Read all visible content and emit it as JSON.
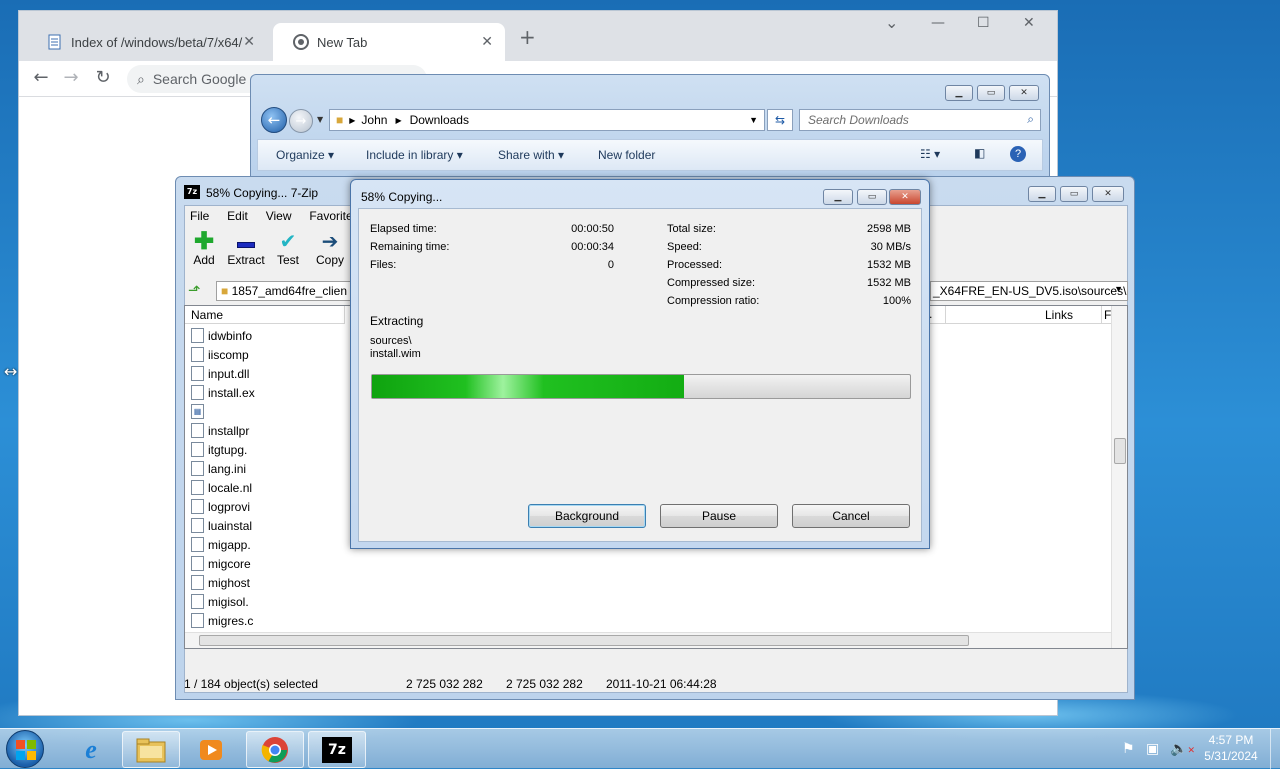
{
  "chrome": {
    "tabs": [
      {
        "label": "Index of /windows/beta/7/x64/",
        "active": false
      },
      {
        "label": "New Tab",
        "active": true
      }
    ],
    "new_tab": "+",
    "omnibox_placeholder": "Search Google or type a URL",
    "window_controls": {
      "minimize": "—",
      "maximize": "☐",
      "close": "✕",
      "tab_search": "⌄"
    }
  },
  "explorer": {
    "breadcrumb": [
      "John",
      "Downloads"
    ],
    "search_placeholder": "Search Downloads",
    "toolbar": [
      "Organize",
      "Include in library",
      "Share with",
      "New folder"
    ]
  },
  "sevenzip": {
    "title": "58% Copying... 7-Zip",
    "title_icon": "7z",
    "menu": [
      "File",
      "Edit",
      "View",
      "Favorites"
    ],
    "toolbar": [
      {
        "label": "Add",
        "icon": "plus-icon",
        "color": "#1fa82e"
      },
      {
        "label": "Extract",
        "icon": "minus-icon",
        "color": "#1c2bbf"
      },
      {
        "label": "Test",
        "icon": "check-icon",
        "color": "#23b5c4"
      },
      {
        "label": "Copy",
        "icon": "arrow-right-icon",
        "color": "#1c4d7a"
      }
    ],
    "path_left": "1857_amd64fre_clien",
    "path_right": "_X64FRE_EN-US_DV5.iso\\sources\\",
    "columns": {
      "name": "Name",
      "links": "Links",
      "f": "F"
    },
    "files": [
      "idwbinfo",
      "iiscomp",
      "input.dll",
      "install.ex",
      "",
      "installpr",
      "itgtupg.",
      "lang.ini",
      "locale.nl",
      "logprovi",
      "luainstal",
      "migapp.",
      "migcore",
      "mighost",
      "migisol.",
      "migres.c",
      "migstore"
    ],
    "status": {
      "selection": "1 / 184 object(s) selected",
      "size": "2 725 032 282",
      "packed": "2 725 032 282",
      "modified": "2011-10-21 06:44:28"
    }
  },
  "dialog": {
    "title": "58% Copying...",
    "left_stats": [
      {
        "label": "Elapsed time:",
        "value": "00:00:50"
      },
      {
        "label": "Remaining time:",
        "value": "00:00:34"
      },
      {
        "label": "Files:",
        "value": "0"
      }
    ],
    "right_stats": [
      {
        "label": "Total size:",
        "value": "2598 MB"
      },
      {
        "label": "Speed:",
        "value": "30 MB/s"
      },
      {
        "label": "Processed:",
        "value": "1532 MB"
      },
      {
        "label": "Compressed size:",
        "value": "1532 MB"
      },
      {
        "label": "Compression ratio:",
        "value": "100%"
      }
    ],
    "operation": "Extracting",
    "current_path": "sources\\",
    "current_file": "install.wim",
    "progress_fraction": 0.58,
    "buttons": {
      "background": "Background",
      "pause": "Pause",
      "cancel": "Cancel"
    }
  },
  "taskbar": {
    "apps": [
      "start-orb",
      "internet-explorer",
      "windows-explorer",
      "media-player",
      "chrome",
      "7-zip"
    ],
    "clock_time": "4:57 PM",
    "clock_date": "5/31/2024"
  }
}
